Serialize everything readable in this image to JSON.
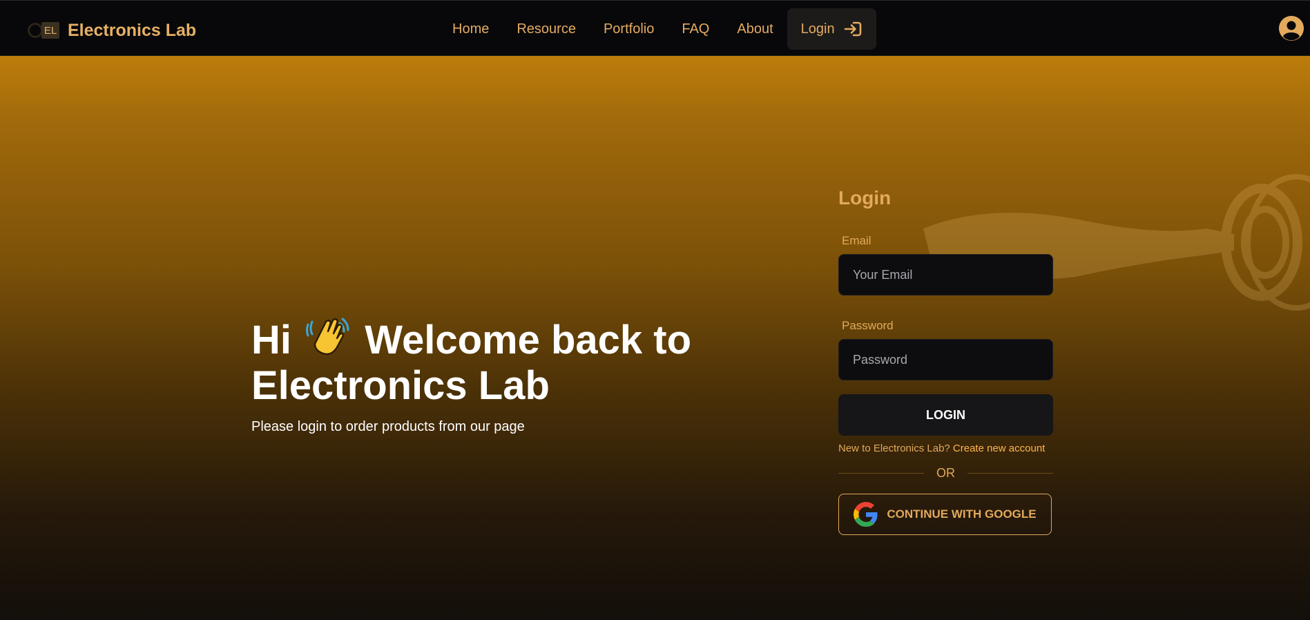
{
  "brand": {
    "logo_text": "EL",
    "name": "Electronics Lab"
  },
  "nav": {
    "items": [
      "Home",
      "Resource",
      "Portfolio",
      "FAQ",
      "About"
    ],
    "login_label": "Login",
    "login_icon": "login-arrow-icon",
    "avatar_icon": "user-circle-icon"
  },
  "hero": {
    "title_part1": "Hi",
    "wave_icon": "waving-hand-icon",
    "title_part2": "Welcome back to",
    "title_line2": "Electronics Lab",
    "subtitle": "Please login to order products from our page"
  },
  "form": {
    "title": "Login",
    "email_label": "Email",
    "email_placeholder": "Your Email",
    "password_label": "Password",
    "password_placeholder": "Password",
    "submit_label": "LOGIN",
    "signup_prompt": "New to Electronics Lab?",
    "signup_link": "Create new account",
    "divider": "OR",
    "google_label": "CONTINUE WITH GOOGLE",
    "google_icon": "google-icon"
  },
  "colors": {
    "accent": "#e3a95c",
    "navbar_bg": "#08080a",
    "hero_top": "#bd7d0b",
    "hero_bottom": "#130f0a",
    "input_bg": "#0d0d10"
  }
}
